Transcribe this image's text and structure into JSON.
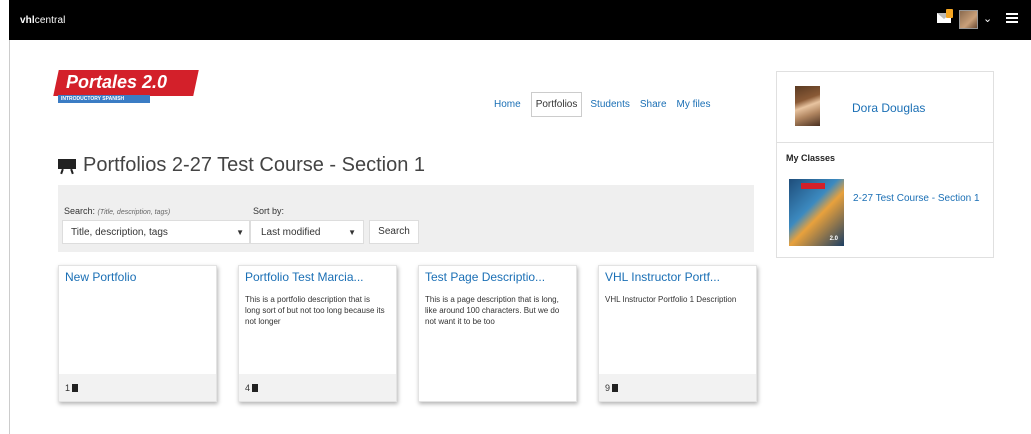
{
  "topbar": {
    "brand_bold": "vhl",
    "brand_rest": "central"
  },
  "logo": {
    "title": "Portales 2.0",
    "subtitle": "INTRODUCTORY SPANISH"
  },
  "nav": {
    "home": "Home",
    "portfolios": "Portfolios",
    "students": "Students",
    "share": "Share",
    "my_files": "My files"
  },
  "page": {
    "title": "Portfolios 2-27 Test Course - Section 1"
  },
  "search": {
    "label": "Search:",
    "hint": "(Title, description, tags)",
    "field_value": "Title, description, tags",
    "sort_label": "Sort by:",
    "sort_value": "Last modified",
    "button": "Search"
  },
  "cards": [
    {
      "title": "New Portfolio",
      "desc": "",
      "count": "1"
    },
    {
      "title": "Portfolio Test Marcia...",
      "desc": "This is a portfolio description that is long sort of but not too long because its not longer",
      "count": "4"
    },
    {
      "title": "Test Page Descriptio...",
      "desc": "This is a page description that is long, like around 100 characters. But we do not want it to be too",
      "count": ""
    },
    {
      "title": "VHL Instructor Portf...",
      "desc": "VHL Instructor Portfolio 1 Description",
      "count": "9"
    }
  ],
  "profile": {
    "name": "Dora Douglas",
    "my_classes": "My Classes",
    "class_name": "2-27 Test Course - Section 1",
    "book_title": "Portales",
    "book_num": "2.0"
  },
  "colors": {
    "link": "#1a6fb5",
    "brand_red": "#d3202a",
    "topbar": "#000000"
  }
}
